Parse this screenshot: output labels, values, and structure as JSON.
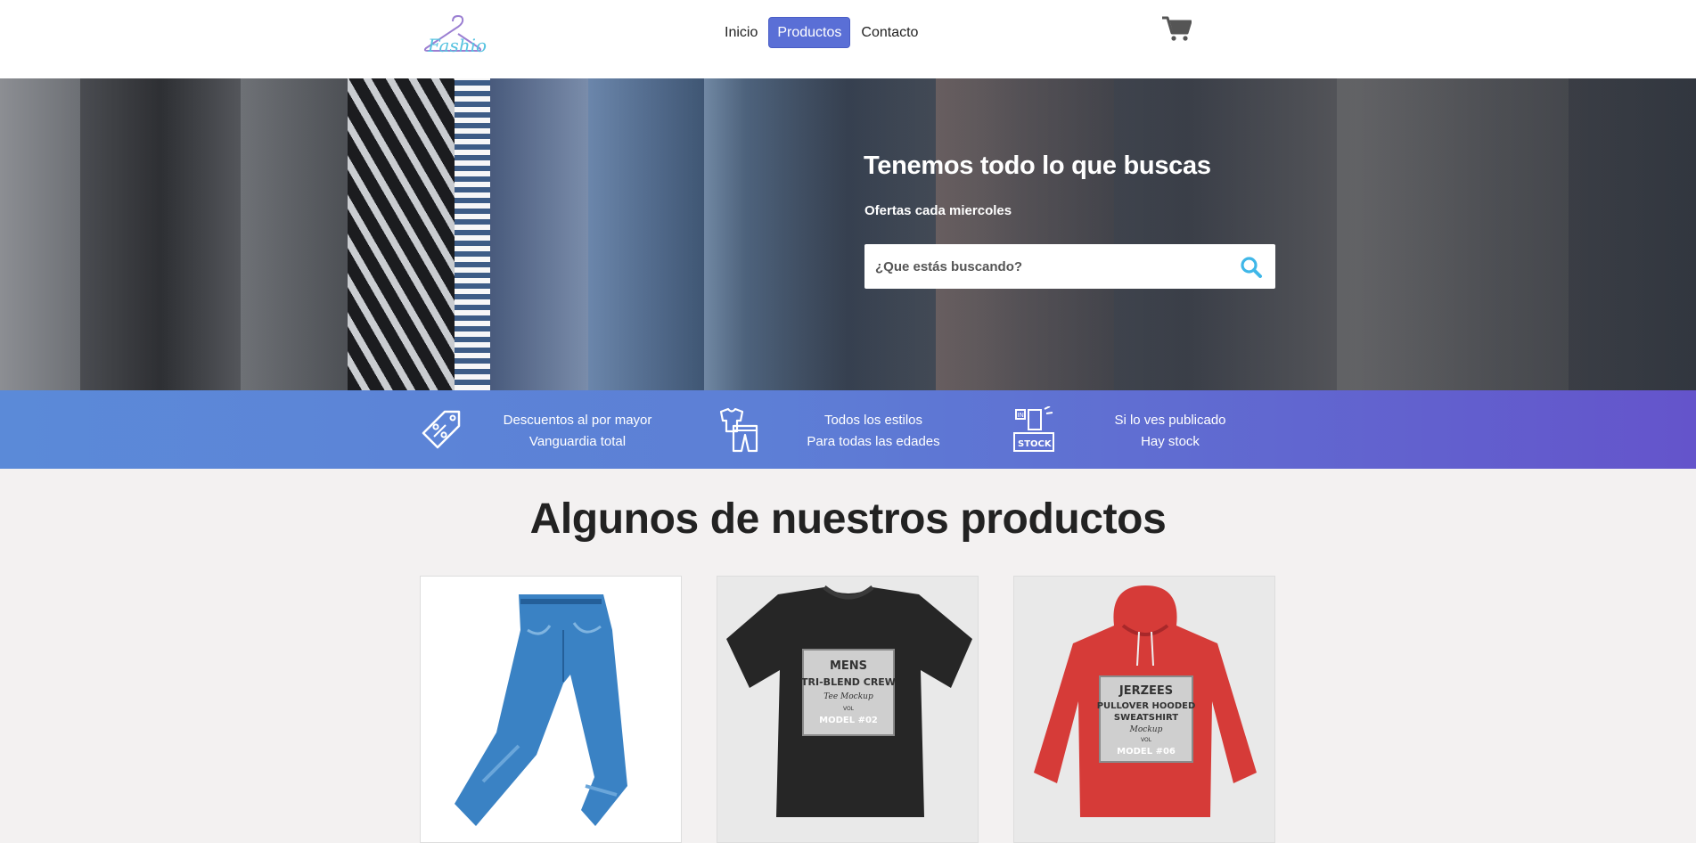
{
  "header": {
    "logo_alt": "Fashion",
    "nav": [
      "Inicio",
      "Productos",
      "Contacto"
    ],
    "active_nav": "Productos"
  },
  "hero": {
    "title": "Tenemos todo lo que buscas",
    "subtitle": "Ofertas cada miercoles",
    "search_placeholder": "¿Que estás buscando?"
  },
  "features": [
    {
      "icon": "discount-tag-icon",
      "line1": "Descuentos al por mayor",
      "line2": "Vanguardia total"
    },
    {
      "icon": "clothes-icon",
      "line1": "Todos los estilos",
      "line2": "Para todas las edades"
    },
    {
      "icon": "in-stock-icon",
      "line1": "Si lo ves publicado",
      "line2": "Hay stock"
    }
  ],
  "products": {
    "title": "Algunos de nuestros productos",
    "items": [
      {
        "name": "jeans"
      },
      {
        "name": "t-shirt",
        "print": [
          "MENS",
          "TRI-BLEND CREW",
          "Tee Mockup",
          "VOL",
          "MODEL #02"
        ]
      },
      {
        "name": "hoodie",
        "print": [
          "JERZEES",
          "PULLOVER HOODED",
          "SWEATSHIRT",
          "Mockup",
          "VOL",
          "MODEL #06"
        ]
      }
    ]
  },
  "colors": {
    "accent": "#5a6fd6",
    "band_start": "#5b8ad8",
    "band_end": "#6454cb",
    "search_icon": "#3fb7e8"
  }
}
